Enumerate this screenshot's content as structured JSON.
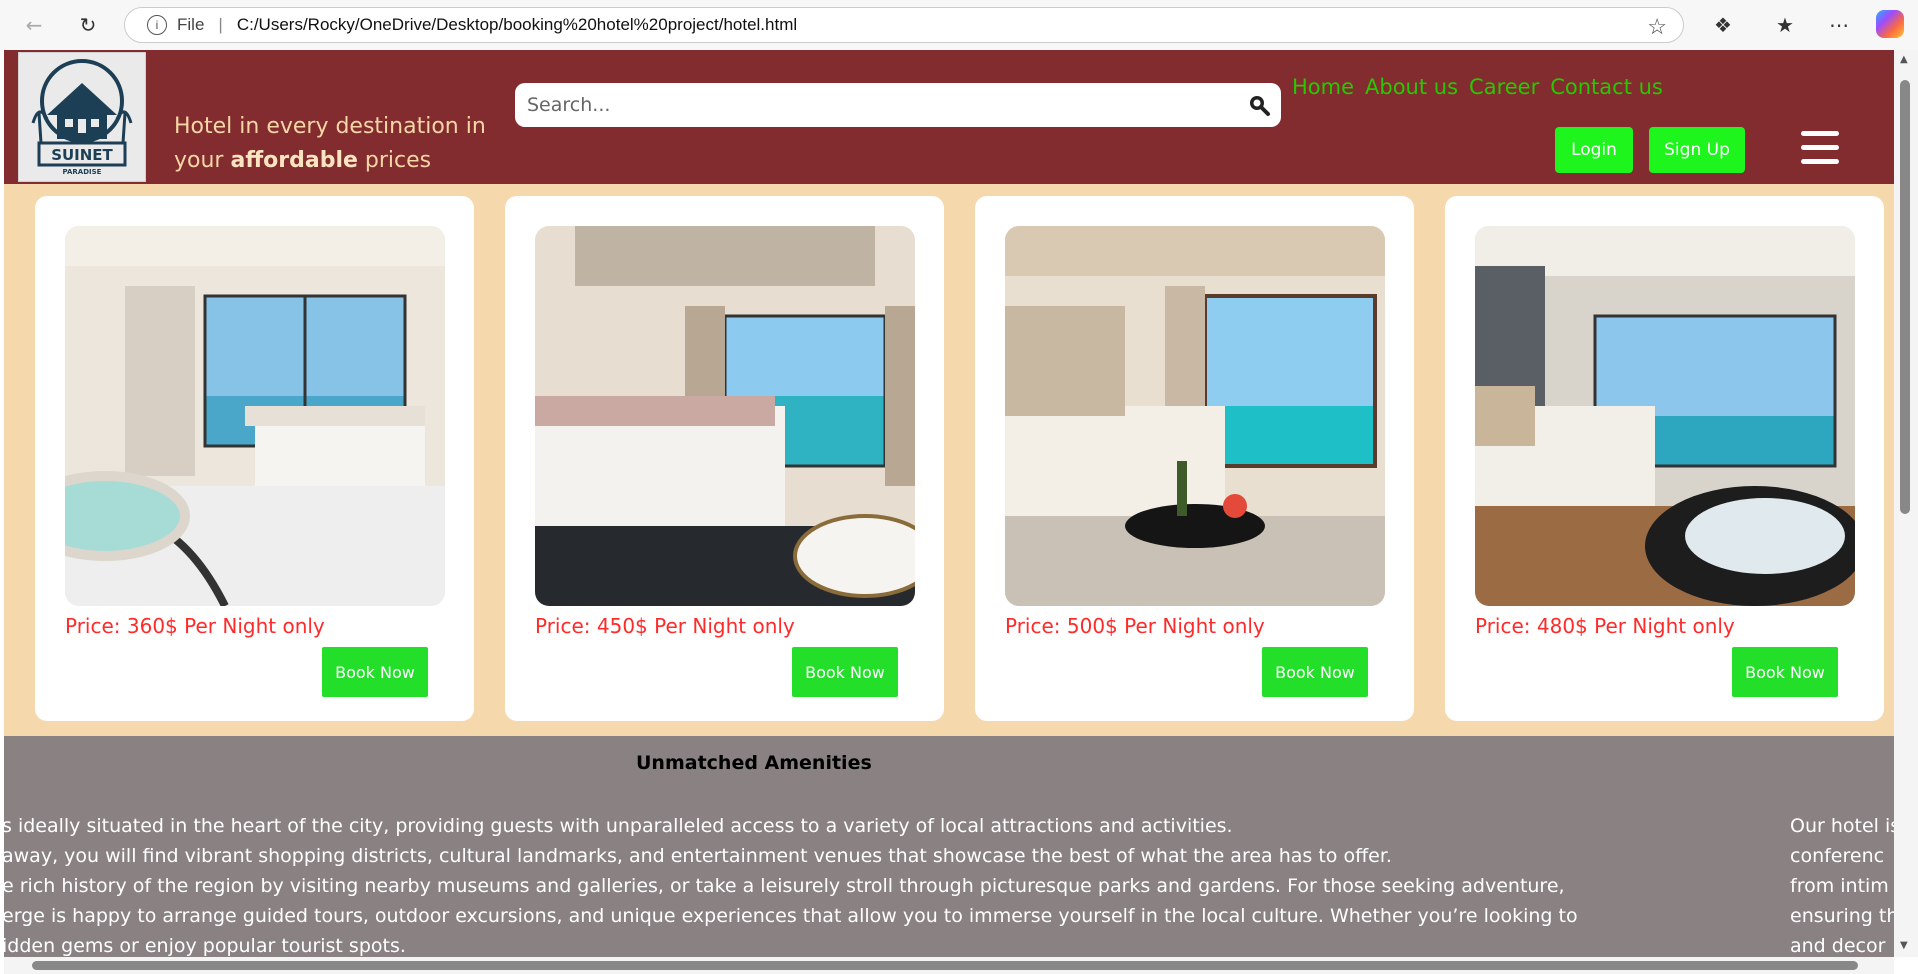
{
  "browser": {
    "protocol_label": "File",
    "separator": "|",
    "url": "C:/Users/Rocky/OneDrive/Desktop/booking%20hotel%20project/hotel.html"
  },
  "header": {
    "logo_text": "SUINET PARADISE",
    "tagline_before": "Hotel in every destination in your ",
    "tagline_bold": "affordable",
    "tagline_after": " prices",
    "search_placeholder": "Search...",
    "nav": [
      "Home",
      "About us",
      "Career",
      "Contact us"
    ],
    "login_label": "Login",
    "signup_label": "Sign Up"
  },
  "rooms": [
    {
      "price": "Price: 360$ Per Night only",
      "book_label": "Book Now"
    },
    {
      "price": "Price: 450$ Per Night only",
      "book_label": "Book Now"
    },
    {
      "price": "Price: 500$ Per Night only",
      "book_label": "Book Now"
    },
    {
      "price": "Price: 480$ Per Night only",
      "book_label": "Book Now"
    }
  ],
  "amenities": {
    "title": "Unmatched Amenities",
    "lines": [
      "s ideally situated in the heart of the city, providing guests with unparalleled access to a variety of local attractions and activities.",
      " away, you will find vibrant shopping districts, cultural landmarks, and entertainment venues that showcase the best of what the area has to offer.",
      "e rich history of the region by visiting nearby museums and galleries, or take a leisurely stroll through picturesque parks and gardens. For those seeking adventure,",
      "erge is happy to arrange guided tours, outdoor excursions, and unique experiences that allow you to immerse yourself in the local culture. Whether you’re looking to",
      "idden gems or enjoy popular tourist spots."
    ],
    "right_lines": [
      "Our hotel is",
      "conferenc",
      "from intim",
      "ensuring th",
      "and decor"
    ]
  },
  "colors": {
    "header_bg": "#832c2f",
    "page_bg": "#f5d8ac",
    "accent_green": "#1df51c",
    "price_red": "#ff2a2a",
    "amenities_bg": "#8a8282"
  }
}
